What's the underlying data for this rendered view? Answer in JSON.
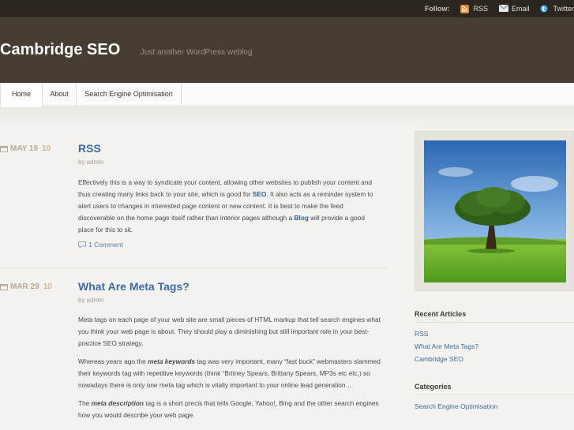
{
  "topbar": {
    "follow": "Follow:",
    "links": [
      {
        "label": "RSS",
        "icon": "rss-icon"
      },
      {
        "label": "Email",
        "icon": "email-icon"
      },
      {
        "label": "Twitter",
        "icon": "twitter-icon"
      }
    ]
  },
  "header": {
    "title": "Cambridge SEO",
    "tagline": "Just another WordPress weblog"
  },
  "nav": {
    "items": [
      "Home",
      "About",
      "Search Engine Optimisation"
    ]
  },
  "posts": [
    {
      "month_day": "MAY 19",
      "year": "10",
      "title": "RSS",
      "byline": "by admin",
      "p1_a": "Effectively this is a way to syndicate your content, allowing other websites to publish your content and thus creating many links back to your site, which is good for ",
      "p1_link1": "SEO",
      "p1_b": ". It also acts as a reminder system to alert users to changes in interested page content or new content. It is best to make the feed discoverable on the home page itself rather than interior pages although a ",
      "p1_link2": "Blog",
      "p1_c": " will provide a good place for this to sit.",
      "comments": "1 Comment"
    },
    {
      "month_day": "MAR 29",
      "year": "10",
      "title": "What Are Meta Tags?",
      "byline": "by admin",
      "p1": "Meta tags on each page of your web site are small pieces of HTML markup that tell search engines what you think your web page is about. They should play a diminishing but still important role in your best-practice SEO strategy.",
      "p2_a": "Whereas years ago the ",
      "p2_em": "meta keywords",
      "p2_b": " tag was very important, many “fast buck” webmasters slammed their keywords tag with repetitive keywords (think “Britney Spears, Brittany Spears, MP3s etc etc.) so nowadays there is only one meta tag which is vitally important to your online lead generation…",
      "p3_a": "The ",
      "p3_em": "meta description",
      "p3_b": " tag is a short precis that tells Google, Yahoo!, Bing and the other search engines how you would describe your web page."
    }
  ],
  "sidebar": {
    "recent_title": "Recent Articles",
    "recent": [
      "RSS",
      "What Are Meta Tags?",
      "Cambridge SEO"
    ],
    "categories_title": "Categories",
    "categories": [
      "Search Engine Optimisation"
    ]
  },
  "colors": {
    "topbar": "#2c2620",
    "header": "#463d33",
    "link": "#3e6aa2",
    "date": "#b7aa97"
  }
}
